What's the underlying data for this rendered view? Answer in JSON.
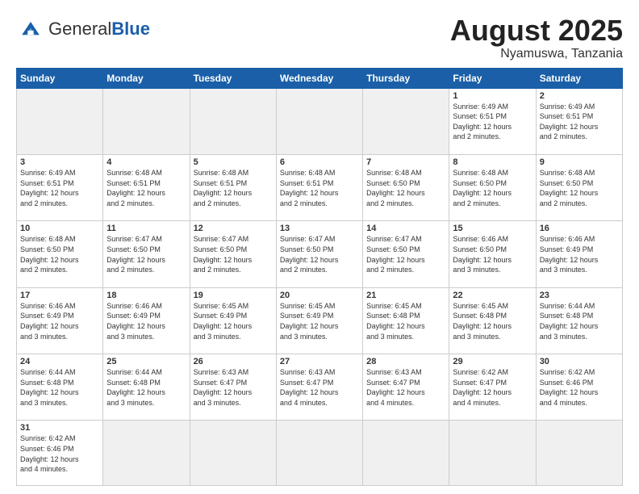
{
  "logo": {
    "text_general": "General",
    "text_blue": "Blue"
  },
  "title": {
    "month_year": "August 2025",
    "location": "Nyamuswa, Tanzania"
  },
  "weekdays": [
    "Sunday",
    "Monday",
    "Tuesday",
    "Wednesday",
    "Thursday",
    "Friday",
    "Saturday"
  ],
  "weeks": [
    [
      {
        "day": "",
        "info": "",
        "empty": true
      },
      {
        "day": "",
        "info": "",
        "empty": true
      },
      {
        "day": "",
        "info": "",
        "empty": true
      },
      {
        "day": "",
        "info": "",
        "empty": true
      },
      {
        "day": "",
        "info": "",
        "empty": true
      },
      {
        "day": "1",
        "info": "Sunrise: 6:49 AM\nSunset: 6:51 PM\nDaylight: 12 hours\nand 2 minutes.",
        "empty": false
      },
      {
        "day": "2",
        "info": "Sunrise: 6:49 AM\nSunset: 6:51 PM\nDaylight: 12 hours\nand 2 minutes.",
        "empty": false
      }
    ],
    [
      {
        "day": "3",
        "info": "Sunrise: 6:49 AM\nSunset: 6:51 PM\nDaylight: 12 hours\nand 2 minutes.",
        "empty": false
      },
      {
        "day": "4",
        "info": "Sunrise: 6:48 AM\nSunset: 6:51 PM\nDaylight: 12 hours\nand 2 minutes.",
        "empty": false
      },
      {
        "day": "5",
        "info": "Sunrise: 6:48 AM\nSunset: 6:51 PM\nDaylight: 12 hours\nand 2 minutes.",
        "empty": false
      },
      {
        "day": "6",
        "info": "Sunrise: 6:48 AM\nSunset: 6:51 PM\nDaylight: 12 hours\nand 2 minutes.",
        "empty": false
      },
      {
        "day": "7",
        "info": "Sunrise: 6:48 AM\nSunset: 6:50 PM\nDaylight: 12 hours\nand 2 minutes.",
        "empty": false
      },
      {
        "day": "8",
        "info": "Sunrise: 6:48 AM\nSunset: 6:50 PM\nDaylight: 12 hours\nand 2 minutes.",
        "empty": false
      },
      {
        "day": "9",
        "info": "Sunrise: 6:48 AM\nSunset: 6:50 PM\nDaylight: 12 hours\nand 2 minutes.",
        "empty": false
      }
    ],
    [
      {
        "day": "10",
        "info": "Sunrise: 6:48 AM\nSunset: 6:50 PM\nDaylight: 12 hours\nand 2 minutes.",
        "empty": false
      },
      {
        "day": "11",
        "info": "Sunrise: 6:47 AM\nSunset: 6:50 PM\nDaylight: 12 hours\nand 2 minutes.",
        "empty": false
      },
      {
        "day": "12",
        "info": "Sunrise: 6:47 AM\nSunset: 6:50 PM\nDaylight: 12 hours\nand 2 minutes.",
        "empty": false
      },
      {
        "day": "13",
        "info": "Sunrise: 6:47 AM\nSunset: 6:50 PM\nDaylight: 12 hours\nand 2 minutes.",
        "empty": false
      },
      {
        "day": "14",
        "info": "Sunrise: 6:47 AM\nSunset: 6:50 PM\nDaylight: 12 hours\nand 2 minutes.",
        "empty": false
      },
      {
        "day": "15",
        "info": "Sunrise: 6:46 AM\nSunset: 6:50 PM\nDaylight: 12 hours\nand 3 minutes.",
        "empty": false
      },
      {
        "day": "16",
        "info": "Sunrise: 6:46 AM\nSunset: 6:49 PM\nDaylight: 12 hours\nand 3 minutes.",
        "empty": false
      }
    ],
    [
      {
        "day": "17",
        "info": "Sunrise: 6:46 AM\nSunset: 6:49 PM\nDaylight: 12 hours\nand 3 minutes.",
        "empty": false
      },
      {
        "day": "18",
        "info": "Sunrise: 6:46 AM\nSunset: 6:49 PM\nDaylight: 12 hours\nand 3 minutes.",
        "empty": false
      },
      {
        "day": "19",
        "info": "Sunrise: 6:45 AM\nSunset: 6:49 PM\nDaylight: 12 hours\nand 3 minutes.",
        "empty": false
      },
      {
        "day": "20",
        "info": "Sunrise: 6:45 AM\nSunset: 6:49 PM\nDaylight: 12 hours\nand 3 minutes.",
        "empty": false
      },
      {
        "day": "21",
        "info": "Sunrise: 6:45 AM\nSunset: 6:48 PM\nDaylight: 12 hours\nand 3 minutes.",
        "empty": false
      },
      {
        "day": "22",
        "info": "Sunrise: 6:45 AM\nSunset: 6:48 PM\nDaylight: 12 hours\nand 3 minutes.",
        "empty": false
      },
      {
        "day": "23",
        "info": "Sunrise: 6:44 AM\nSunset: 6:48 PM\nDaylight: 12 hours\nand 3 minutes.",
        "empty": false
      }
    ],
    [
      {
        "day": "24",
        "info": "Sunrise: 6:44 AM\nSunset: 6:48 PM\nDaylight: 12 hours\nand 3 minutes.",
        "empty": false
      },
      {
        "day": "25",
        "info": "Sunrise: 6:44 AM\nSunset: 6:48 PM\nDaylight: 12 hours\nand 3 minutes.",
        "empty": false
      },
      {
        "day": "26",
        "info": "Sunrise: 6:43 AM\nSunset: 6:47 PM\nDaylight: 12 hours\nand 3 minutes.",
        "empty": false
      },
      {
        "day": "27",
        "info": "Sunrise: 6:43 AM\nSunset: 6:47 PM\nDaylight: 12 hours\nand 4 minutes.",
        "empty": false
      },
      {
        "day": "28",
        "info": "Sunrise: 6:43 AM\nSunset: 6:47 PM\nDaylight: 12 hours\nand 4 minutes.",
        "empty": false
      },
      {
        "day": "29",
        "info": "Sunrise: 6:42 AM\nSunset: 6:47 PM\nDaylight: 12 hours\nand 4 minutes.",
        "empty": false
      },
      {
        "day": "30",
        "info": "Sunrise: 6:42 AM\nSunset: 6:46 PM\nDaylight: 12 hours\nand 4 minutes.",
        "empty": false
      }
    ],
    [
      {
        "day": "31",
        "info": "Sunrise: 6:42 AM\nSunset: 6:46 PM\nDaylight: 12 hours\nand 4 minutes.",
        "empty": false
      },
      {
        "day": "",
        "info": "",
        "empty": true
      },
      {
        "day": "",
        "info": "",
        "empty": true
      },
      {
        "day": "",
        "info": "",
        "empty": true
      },
      {
        "day": "",
        "info": "",
        "empty": true
      },
      {
        "day": "",
        "info": "",
        "empty": true
      },
      {
        "day": "",
        "info": "",
        "empty": true
      }
    ]
  ]
}
